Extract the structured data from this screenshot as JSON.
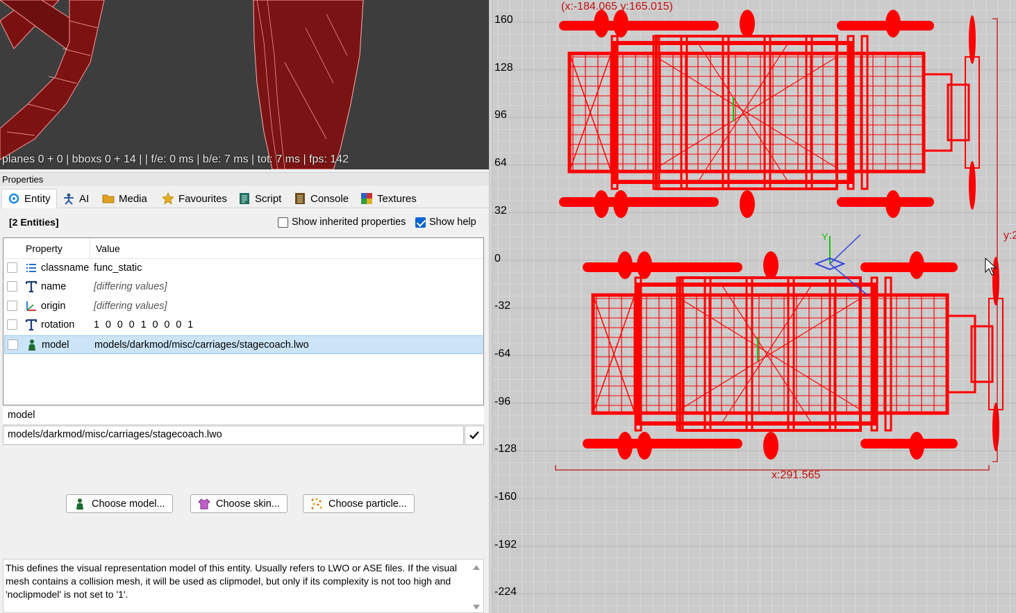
{
  "camera_view": {
    "stats": "planes 0 + 0 | bboxs 0 + 14 |  | f/e: 0 ms | b/e: 7 ms | tot: 7 ms | fps: 142"
  },
  "properties": {
    "panel_title": "Properties",
    "tabs": [
      {
        "label": "Entity",
        "icon": "entity-icon",
        "active": true
      },
      {
        "label": "AI",
        "icon": "ai-icon"
      },
      {
        "label": "Media",
        "icon": "folder-icon"
      },
      {
        "label": "Favourites",
        "icon": "star-icon"
      },
      {
        "label": "Script",
        "icon": "script-icon"
      },
      {
        "label": "Console",
        "icon": "console-icon"
      },
      {
        "label": "Textures",
        "icon": "textures-icon"
      }
    ],
    "selection_label": "[2 Entities]",
    "show_inherited": {
      "label": "Show inherited properties",
      "checked": false
    },
    "show_help": {
      "label": "Show help",
      "checked": true
    },
    "columns": [
      "Property",
      "Value"
    ],
    "rows": [
      {
        "key": "classname",
        "value": "func_static",
        "icon": "list-icon"
      },
      {
        "key": "name",
        "value": "[differing values]",
        "icon": "text-icon"
      },
      {
        "key": "origin",
        "value": "[differing values]",
        "icon": "axes-icon"
      },
      {
        "key": "rotation",
        "value": "1 0 0 0 1 0 0 0 1",
        "icon": "text-icon"
      },
      {
        "key": "model",
        "value": "models/darkmod/misc/carriages/stagecoach.lwo",
        "icon": "model-icon",
        "selected": true
      }
    ],
    "key_field": "model",
    "value_field": "models/darkmod/misc/carriages/stagecoach.lwo",
    "buttons": {
      "choose_model": "Choose model...",
      "choose_skin": "Choose skin...",
      "choose_particle": "Choose particle..."
    },
    "help_text": "This defines the visual representation model of this entity. Usually refers to LWO or ASE files. If the visual mesh contains a collision mesh, it will be used as clipmodel, but only if its complexity is not too high and 'noclipmodel' is not set to '1'."
  },
  "ortho_view": {
    "cursor_coords": "(x:-184.065  y:165.015)",
    "y_axis_labels": [
      "160",
      "128",
      "96",
      "64",
      "32",
      "0",
      "-32",
      "-64",
      "-96",
      "-128",
      "-160",
      "-192",
      "-224"
    ],
    "size_x": "x:291.565",
    "size_y": "y:2",
    "axis_label_y": "Y"
  },
  "colors": {
    "wireframe": "#ff0000",
    "grid_bg": "#cbcbcb",
    "selection_blue": "#cce4f7",
    "accent": "#0a64d2"
  }
}
